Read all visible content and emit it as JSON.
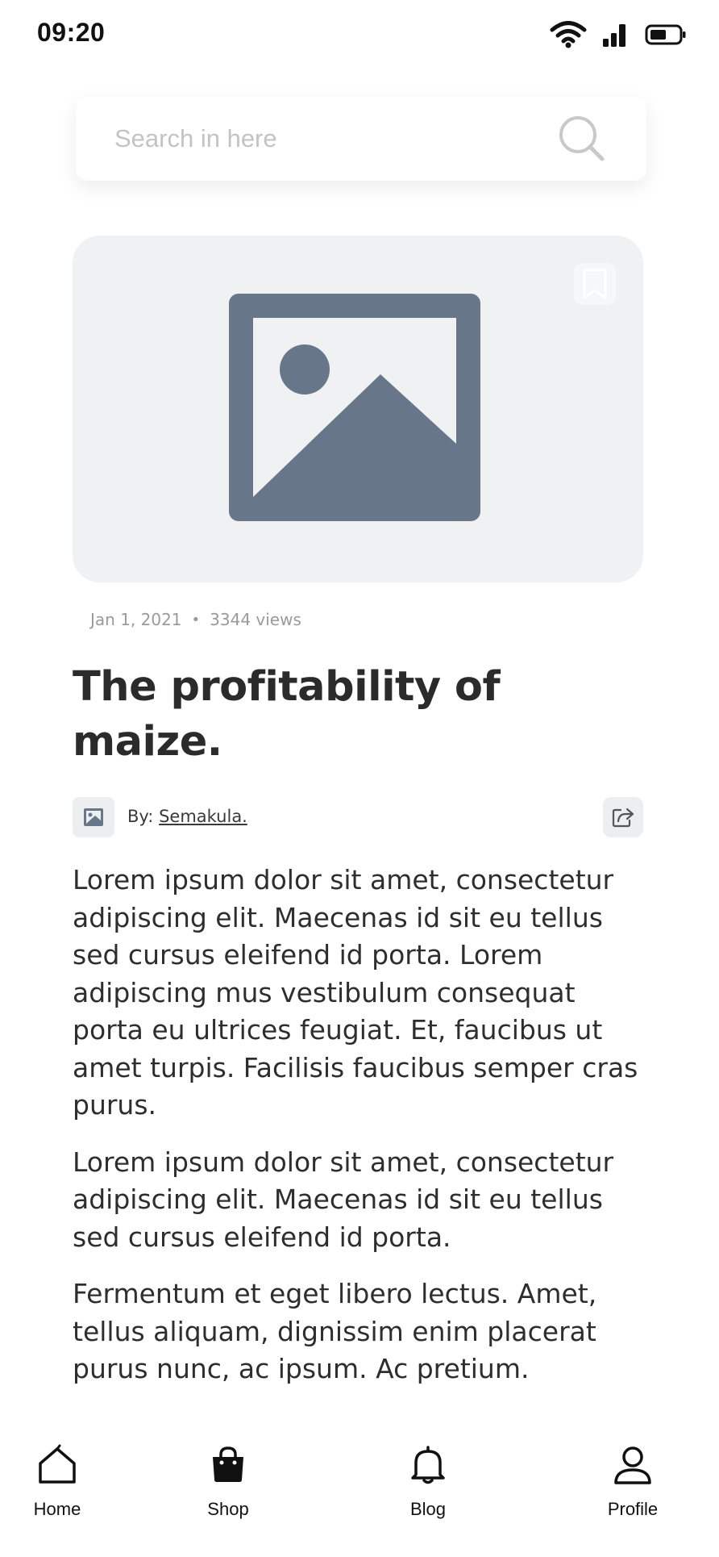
{
  "status_bar": {
    "time": "09:20",
    "icons": [
      "wifi-icon",
      "signal-icon",
      "battery-icon"
    ]
  },
  "search": {
    "placeholder": "Search in here",
    "icon": "search-icon"
  },
  "article": {
    "date": "Jan 1, 2021",
    "separator": "•",
    "views": "3344 views",
    "title": "The profitability of maize.",
    "author_prefix": "By:",
    "author_name": "Semakula.",
    "paragraphs": [
      "Lorem ipsum dolor sit amet, consectetur adipiscing elit. Maecenas id sit eu tellus sed cursus eleifend id porta. Lorem adipiscing mus vestibulum consequat porta eu ultrices feugiat. Et, faucibus ut amet turpis. Facilisis faucibus semper cras purus.",
      "Lorem ipsum dolor sit amet, consectetur adipiscing elit. Maecenas id sit eu tellus sed cursus eleifend id porta.",
      "Fermentum et eget libero lectus. Amet, tellus aliquam, dignissim enim placerat purus nunc, ac ipsum. Ac pretium."
    ]
  },
  "bottom_nav": {
    "items": [
      {
        "label": "Home",
        "icon": "home-icon"
      },
      {
        "label": "Shop",
        "icon": "shopping-bag-icon"
      },
      {
        "label": "Blog",
        "icon": "bell-icon"
      },
      {
        "label": "Profile",
        "icon": "user-icon"
      }
    ]
  },
  "colors": {
    "hero_background": "#f0f1f3",
    "image_placeholder": "#677789",
    "text_primary": "#2b2b2b",
    "text_muted": "#9a9a9a"
  }
}
